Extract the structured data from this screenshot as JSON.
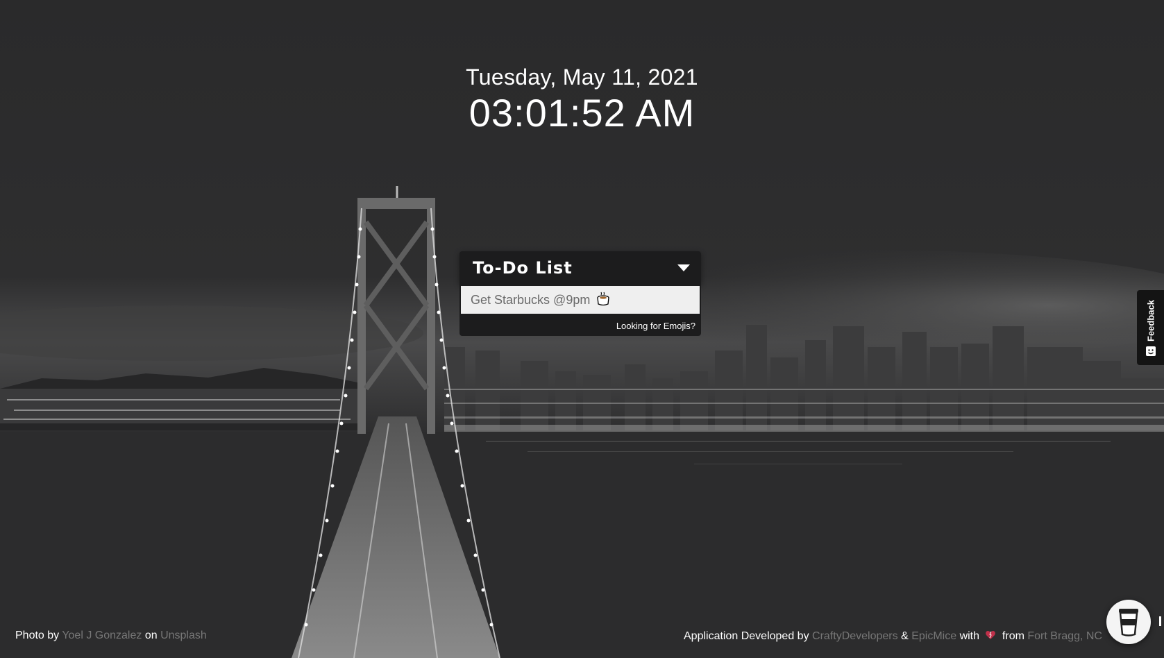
{
  "header": {
    "date": "Tuesday, May 11, 2021",
    "time": "03:01:52 AM"
  },
  "todo": {
    "title": "To-Do List",
    "input_placeholder": "Get Starbucks @9pm",
    "emoji_link": "Looking for Emojis?"
  },
  "feedback": {
    "label": "Feedback"
  },
  "footer": {
    "left": {
      "prefix": "Photo by",
      "photographer": "Yoel J Gonzalez",
      "middle": "on",
      "source": "Unsplash"
    },
    "right": {
      "prefix": "Application Developed by",
      "dev1": "CraftyDevelopers",
      "amp": "&",
      "dev2": "EpicMice",
      "with": "with",
      "from": "from",
      "location": "Fort Bragg, NC"
    }
  },
  "icons": {
    "coffee": "coffee-cup-emoji",
    "toggle": "caret-down-icon",
    "heart": "heart-icon",
    "cup": "coffee-cup-icon",
    "feedback": "chat-icon"
  },
  "colors": {
    "panel": "#1c1c1d",
    "link_muted": "#777777",
    "heart": "#c0304a",
    "background": "#2b2b2c"
  }
}
